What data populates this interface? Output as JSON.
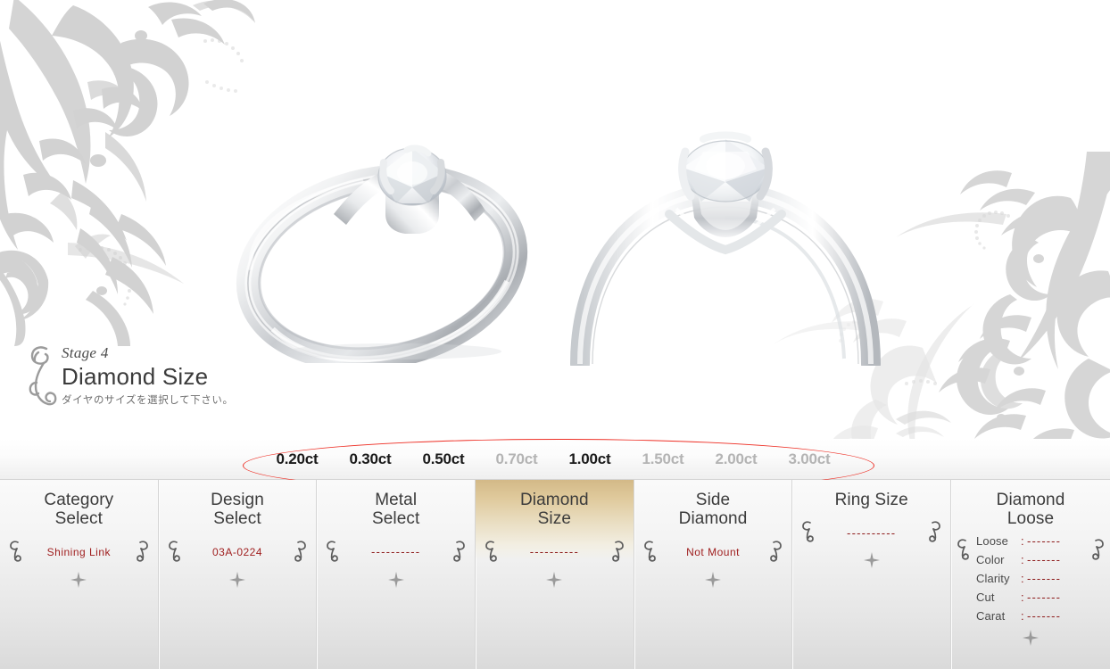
{
  "hero": {
    "stage_label": "Stage 4",
    "stage_title": "Diamond Size",
    "stage_subtitle": "ダイヤのサイズを選択して下さい。",
    "ring_left_alt": "diamond-solitaire-ring-angle-view",
    "ring_right_alt": "diamond-solitaire-ring-front-view"
  },
  "carat_bar": {
    "highlight_color": "#ee3026",
    "options": [
      {
        "label": "0.20ct",
        "available": true
      },
      {
        "label": "0.30ct",
        "available": true
      },
      {
        "label": "0.50ct",
        "available": true
      },
      {
        "label": "0.70ct",
        "available": false
      },
      {
        "label": "1.00ct",
        "available": true
      },
      {
        "label": "1.50ct",
        "available": false
      },
      {
        "label": "2.00ct",
        "available": false
      },
      {
        "label": "3.00ct",
        "available": false
      }
    ]
  },
  "steps": [
    {
      "title_line1": "Category",
      "title_line2": "Select",
      "value": "Shining Link",
      "is_dash": false,
      "active": false
    },
    {
      "title_line1": "Design",
      "title_line2": "Select",
      "value": "03A-0224",
      "is_dash": false,
      "active": false
    },
    {
      "title_line1": "Metal",
      "title_line2": "Select",
      "value": "----------",
      "is_dash": true,
      "active": false
    },
    {
      "title_line1": "Diamond",
      "title_line2": "Size",
      "value": "----------",
      "is_dash": true,
      "active": true
    },
    {
      "title_line1": "Side",
      "title_line2": "Diamond",
      "value": "Not Mount",
      "is_dash": false,
      "active": false
    },
    {
      "title_line1": "Ring Size",
      "title_line2": "",
      "value": "----------",
      "is_dash": true,
      "active": false
    }
  ],
  "loose_panel": {
    "title_line1": "Diamond",
    "title_line2": "Loose",
    "rows": [
      {
        "key": "Loose",
        "value": "-------"
      },
      {
        "key": "Color",
        "value": "-------"
      },
      {
        "key": "Clarity",
        "value": "-------"
      },
      {
        "key": "Cut",
        "value": "-------"
      },
      {
        "key": "Carat",
        "value": "-------"
      }
    ]
  },
  "colors": {
    "accent_red": "#a02020",
    "dash_red": "#8e1c1c",
    "annotation_red": "#ee3026",
    "gold_highlight": "#d3b987",
    "ornament_gray": "#d2d2d2"
  }
}
